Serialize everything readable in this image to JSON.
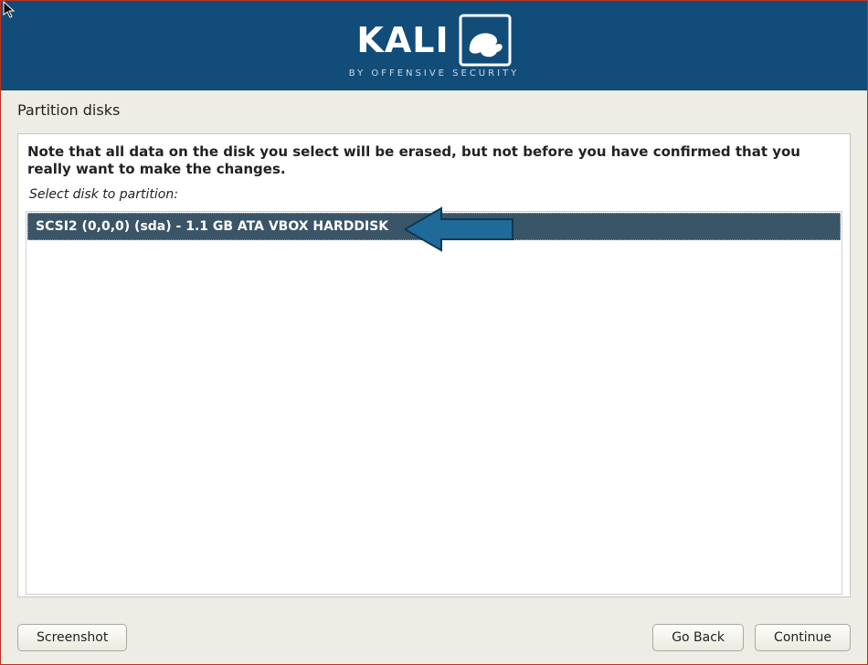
{
  "banner": {
    "title": "KALI",
    "subtitle": "BY OFFENSIVE SECURITY"
  },
  "pageTitle": "Partition disks",
  "warning": "Note that all data on the disk you select will be erased, but not before you have confirmed that you really want to make the changes.",
  "selectHint": "Select disk to partition:",
  "disks": [
    {
      "label": "SCSI2 (0,0,0) (sda) - 1.1 GB ATA VBOX HARDDISK"
    }
  ],
  "buttons": {
    "screenshot": "Screenshot",
    "goBack": "Go Back",
    "continue": "Continue"
  }
}
